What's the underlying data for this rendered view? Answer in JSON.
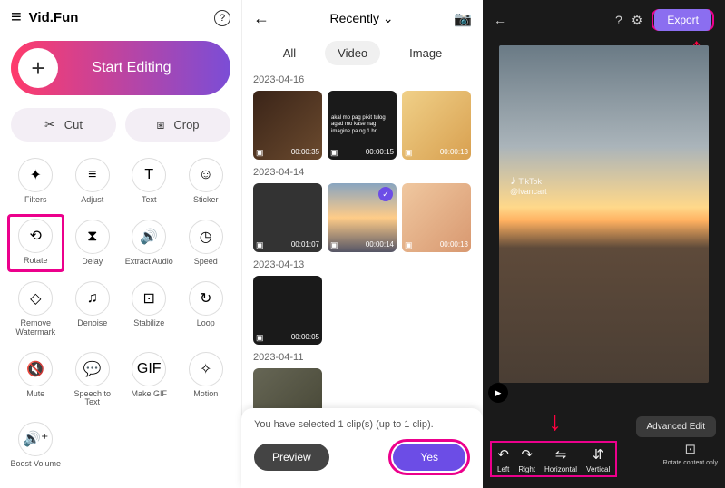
{
  "panel1": {
    "app_title": "Vid.Fun",
    "start_label": "Start Editing",
    "cut_label": "Cut",
    "crop_label": "Crop",
    "tools": [
      {
        "label": "Filters",
        "icon": "✦"
      },
      {
        "label": "Adjust",
        "icon": "≡"
      },
      {
        "label": "Text",
        "icon": "T"
      },
      {
        "label": "Sticker",
        "icon": "☺"
      },
      {
        "label": "Rotate",
        "icon": "⟲"
      },
      {
        "label": "Delay",
        "icon": "⧗"
      },
      {
        "label": "Extract Audio",
        "icon": "🔊"
      },
      {
        "label": "Speed",
        "icon": "◷"
      },
      {
        "label": "Remove Watermark",
        "icon": "◇"
      },
      {
        "label": "Denoise",
        "icon": "♫"
      },
      {
        "label": "Stabilize",
        "icon": "⊡"
      },
      {
        "label": "Loop",
        "icon": "↻"
      },
      {
        "label": "Mute",
        "icon": "🔇"
      },
      {
        "label": "Speech to Text",
        "icon": "💬"
      },
      {
        "label": "Make GIF",
        "icon": "GIF"
      },
      {
        "label": "Motion",
        "icon": "✧"
      },
      {
        "label": "Boost Volume",
        "icon": "🔊⁺"
      }
    ]
  },
  "panel2": {
    "recently_label": "Recently",
    "tabs": {
      "all": "All",
      "video": "Video",
      "image": "Image"
    },
    "active_tab": "Video",
    "sections": [
      {
        "date": "2023-04-16",
        "clips": [
          {
            "dur": "00:00:35"
          },
          {
            "dur": "00:00:15",
            "text": "akal mo pag pikit tulog agad mo kase nag imagine pa ng 1 hr"
          },
          {
            "dur": "00:00:13"
          }
        ]
      },
      {
        "date": "2023-04-14",
        "clips": [
          {
            "dur": "00:01:07"
          },
          {
            "dur": "00:00:14",
            "selected": true
          },
          {
            "dur": "00:00:13"
          }
        ]
      },
      {
        "date": "2023-04-13",
        "clips": [
          {
            "dur": "00:00:05"
          }
        ]
      },
      {
        "date": "2023-04-11",
        "clips": [
          {}
        ]
      }
    ],
    "selection_text": "You have selected 1 clip(s) (up to 1 clip).",
    "preview_label": "Preview",
    "yes_label": "Yes"
  },
  "panel3": {
    "export_label": "Export",
    "watermark": {
      "logo": "♪",
      "brand": "TikTok",
      "handle": "@lvancart"
    },
    "advanced_edit": "Advanced Edit",
    "rotate_buttons": [
      {
        "label": "Left",
        "icon": "↶"
      },
      {
        "label": "Right",
        "icon": "↷"
      },
      {
        "label": "Horizontal",
        "icon": "⇋"
      },
      {
        "label": "Vertical",
        "icon": "⇵"
      }
    ],
    "rotate_content_only": "Rotate content only"
  }
}
